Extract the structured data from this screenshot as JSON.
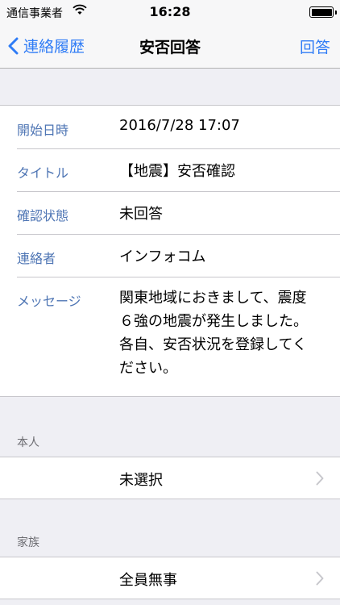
{
  "status_bar": {
    "carrier": "通信事業者",
    "time": "16:28"
  },
  "nav": {
    "back_label": "連絡履歴",
    "title": "安否回答",
    "action_label": "回答"
  },
  "details": [
    {
      "label": "開始日時",
      "value": "2016/7/28 17:07"
    },
    {
      "label": "タイトル",
      "value": "【地震】安否確認"
    },
    {
      "label": "確認状態",
      "value": "未回答"
    },
    {
      "label": "連絡者",
      "value": "インフォコム"
    },
    {
      "label": "メッセージ",
      "value": "関東地域におきまして、震度\n６強の地震が発生しました。\n各自、安否状況を登録してく\nださい。"
    }
  ],
  "self_section": {
    "header": "本人",
    "value": "未選択"
  },
  "family_section": {
    "header": "家族",
    "value": "全員無事"
  },
  "colors": {
    "accent": "#2f7cf6",
    "label": "#4e75b4",
    "background": "#efeff4"
  }
}
